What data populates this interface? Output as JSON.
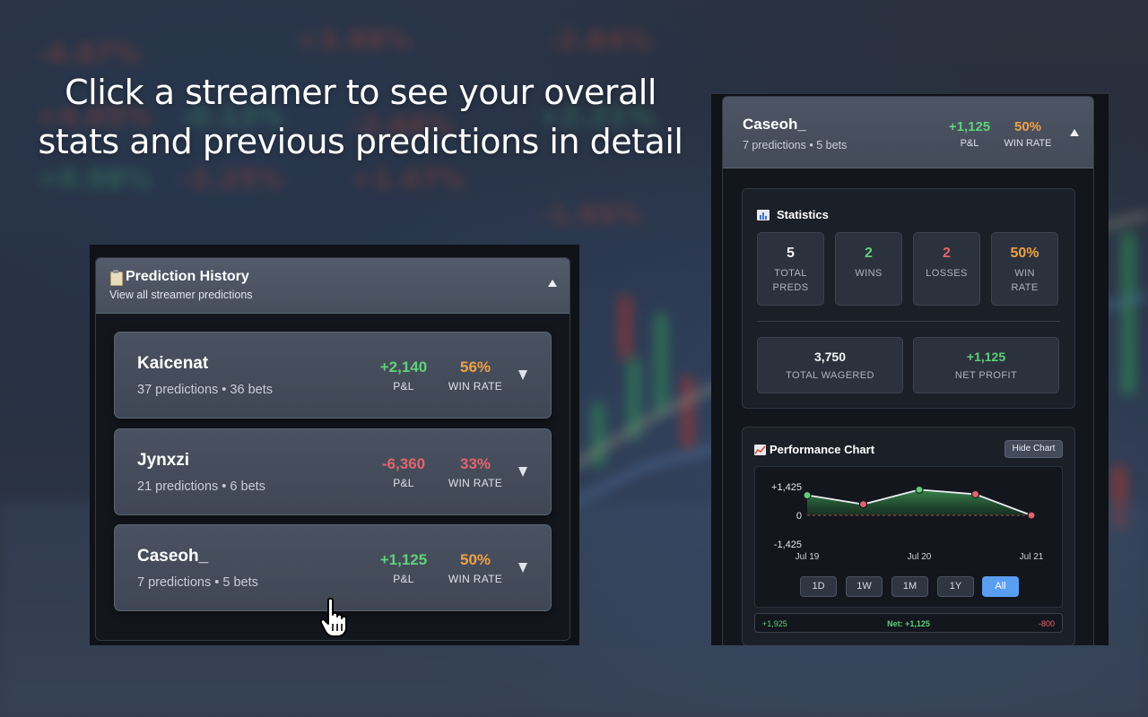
{
  "headline": {
    "line1": "Click a streamer to see your overall",
    "line2": "stats and previous predictions in detail"
  },
  "history": {
    "title": "Prediction History",
    "subtitle": "View all streamer predictions",
    "icon": "clipboard-icon",
    "streamers": [
      {
        "name": "Kaicenat",
        "meta": "37 predictions • 36 bets",
        "pnl": "+2,140",
        "pnl_sign": "positive",
        "pnl_label": "P&L",
        "winrate": "56%",
        "winrate_label": "WIN RATE"
      },
      {
        "name": "Jynxzi",
        "meta": "21 predictions • 6 bets",
        "pnl": "-6,360",
        "pnl_sign": "negative",
        "pnl_label": "P&L",
        "winrate": "33%",
        "winrate_label": "WIN RATE"
      },
      {
        "name": "Caseoh_",
        "meta": "7 predictions • 5 bets",
        "pnl": "+1,125",
        "pnl_sign": "positive",
        "pnl_label": "P&L",
        "winrate": "50%",
        "winrate_label": "WIN RATE"
      }
    ]
  },
  "detail": {
    "name": "Caseoh_",
    "meta": "7 predictions • 5 bets",
    "pnl": "+1,125",
    "pnl_label": "P&L",
    "winrate": "50%",
    "winrate_label": "WIN RATE",
    "statistics": {
      "title": "Statistics",
      "icon": "bar-chart-icon",
      "total_preds": "5",
      "total_preds_label_1": "TOTAL",
      "total_preds_label_2": "PREDS",
      "wins": "2",
      "wins_label": "WINS",
      "losses": "2",
      "losses_label": "LOSSES",
      "winrate": "50%",
      "winrate_label_1": "WIN",
      "winrate_label_2": "RATE",
      "total_wagered": "3,750",
      "total_wagered_label": "TOTAL WAGERED",
      "net_profit": "+1,125",
      "net_profit_label": "NET PROFIT"
    },
    "performance": {
      "title": "Performance Chart",
      "icon": "line-chart-icon",
      "hide_button": "Hide Chart",
      "ranges": [
        "1D",
        "1W",
        "1M",
        "1Y",
        "All"
      ],
      "active_range": "All",
      "summary_high": "+1,925",
      "summary_net": "Net: +1,125",
      "summary_low": "-800"
    }
  },
  "colors": {
    "positive": "#5fd07a",
    "negative": "#e5636b",
    "winrate": "#f0a042",
    "accent": "#5a9ef2"
  },
  "chart_data": {
    "type": "area",
    "y_tick_labels": [
      "+1,425",
      "0",
      "-1,425"
    ],
    "ylim": [
      -1425,
      1425
    ],
    "x_tick_labels": [
      "Jul 19",
      "Jul 20",
      "Jul 21"
    ],
    "points": [
      {
        "y": 1000,
        "outcome": "win"
      },
      {
        "y": 550,
        "outcome": "loss"
      },
      {
        "y": 1275,
        "outcome": "win"
      },
      {
        "y": 1050,
        "outcome": "loss"
      },
      {
        "y": 0,
        "outcome": "loss"
      }
    ],
    "zero_line": true
  }
}
